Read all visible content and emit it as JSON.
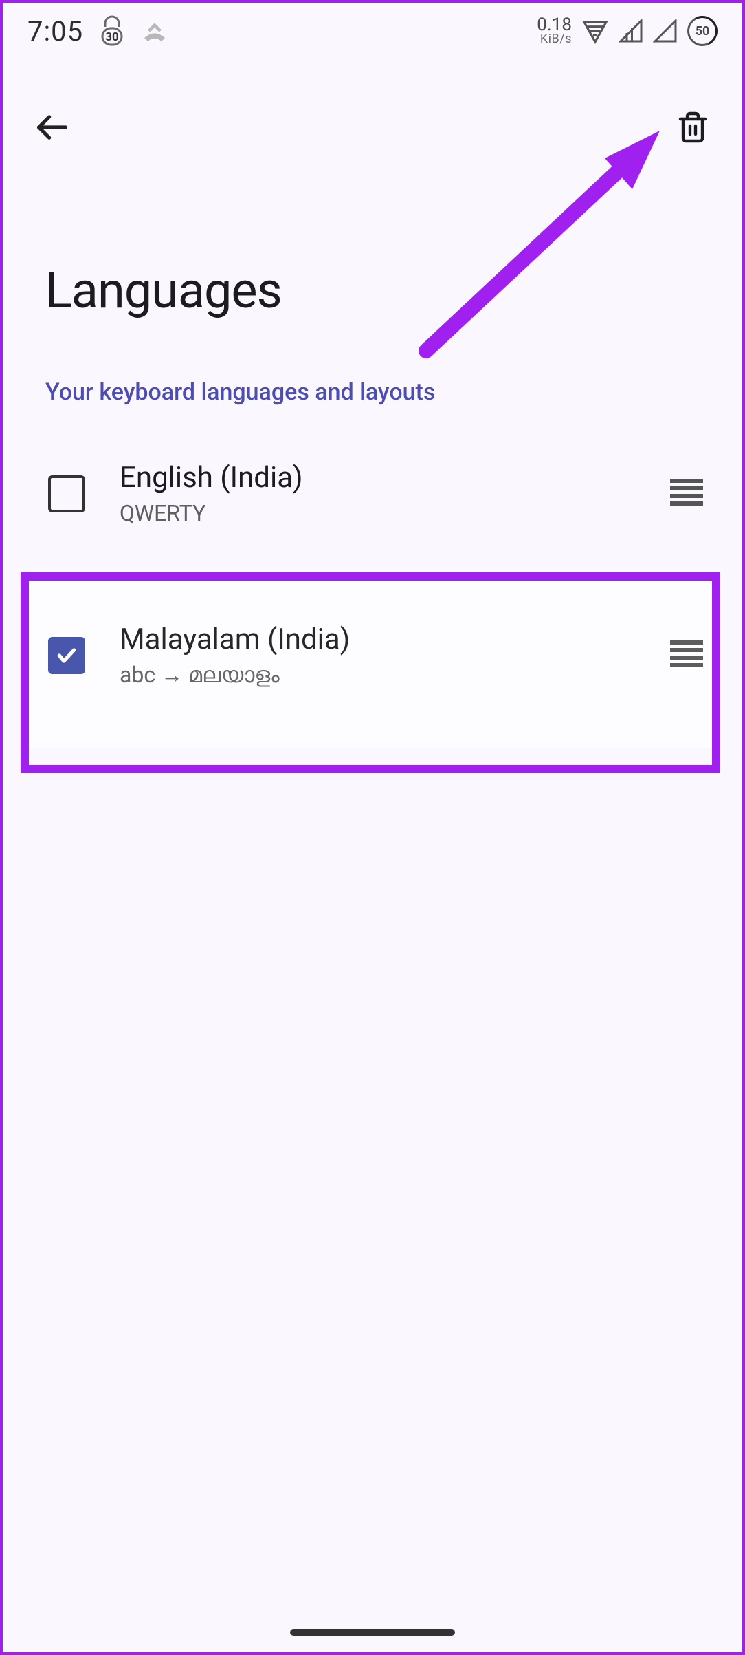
{
  "status": {
    "time": "7:05",
    "notif_badge": "30",
    "net_speed_value": "0.18",
    "net_speed_unit": "KiB/s",
    "battery": "50"
  },
  "page": {
    "title": "Languages",
    "section_label": "Your keyboard languages and layouts"
  },
  "languages": [
    {
      "name": "English (India)",
      "layout": "QWERTY",
      "checked": false
    },
    {
      "name": "Malayalam (India)",
      "layout": "abc → മലയാളം",
      "checked": true
    }
  ]
}
